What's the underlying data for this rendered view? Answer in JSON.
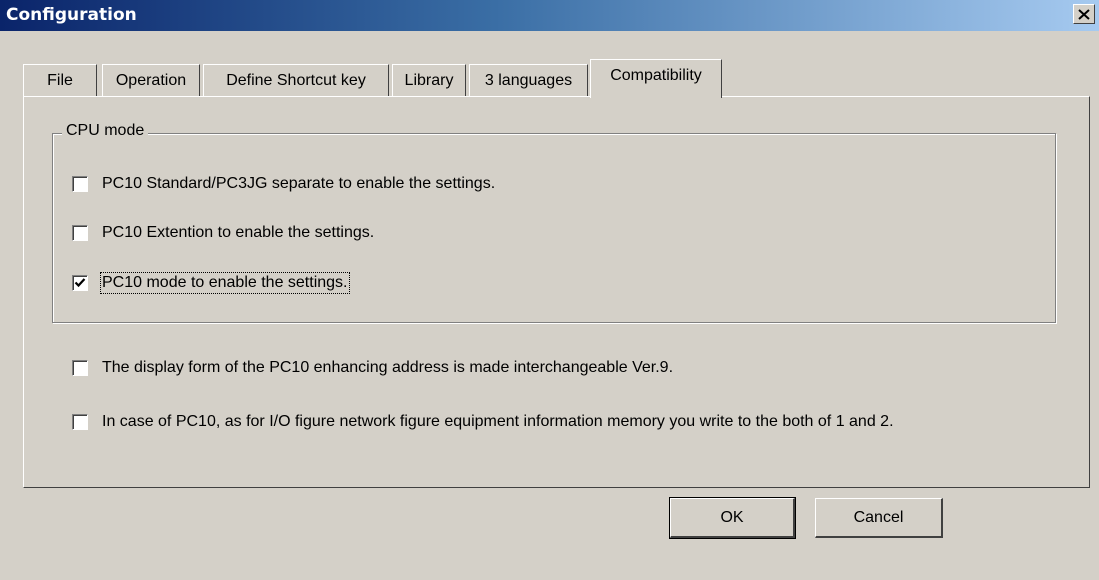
{
  "window": {
    "title": "Configuration",
    "close_label": "×"
  },
  "tabs": [
    {
      "label": "File",
      "active": false
    },
    {
      "label": "Operation",
      "active": false
    },
    {
      "label": "Define Shortcut key",
      "active": false
    },
    {
      "label": "Library",
      "active": false
    },
    {
      "label": "3 languages",
      "active": false
    },
    {
      "label": "Compatibility",
      "active": true
    }
  ],
  "cpu_mode": {
    "legend": "CPU mode",
    "options": [
      {
        "label": "PC10 Standard/PC3JG separate to enable the settings.",
        "checked": false
      },
      {
        "label": "PC10 Extention to enable the settings.",
        "checked": false
      },
      {
        "label": "PC10 mode to enable the settings.",
        "checked": true
      }
    ]
  },
  "options": [
    {
      "label": "The display form of the PC10 enhancing address is made interchangeable Ver.9.",
      "checked": false
    },
    {
      "label": "In case of PC10, as for I/O figure network figure equipment information memory you write to the both of 1 and 2.",
      "checked": false
    }
  ],
  "buttons": {
    "ok": "OK",
    "cancel": "Cancel"
  }
}
